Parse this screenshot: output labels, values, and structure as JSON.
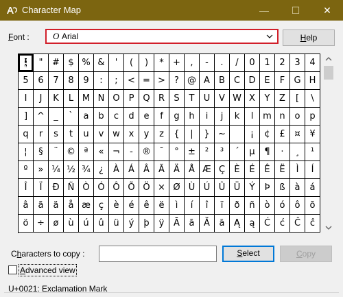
{
  "window": {
    "title": "Character Map",
    "minimize_glyph": "—",
    "maximize_glyph": "☐",
    "close_glyph": "✕"
  },
  "font": {
    "label": "Font :",
    "glyph": "O",
    "value": "Arial"
  },
  "help_button": "Help",
  "grid": {
    "columns": 20,
    "selected_index": 0,
    "chars": [
      "!",
      "\"",
      "#",
      "$",
      "%",
      "&",
      "'",
      "(",
      ")",
      "*",
      "+",
      ",",
      "-",
      ".",
      "/",
      "0",
      "1",
      "2",
      "3",
      "4",
      "5",
      "6",
      "7",
      "8",
      "9",
      ":",
      ";",
      "<",
      "=",
      ">",
      "?",
      "@",
      "A",
      "B",
      "C",
      "D",
      "E",
      "F",
      "G",
      "H",
      "I",
      "J",
      "K",
      "L",
      "M",
      "N",
      "O",
      "P",
      "Q",
      "R",
      "S",
      "T",
      "U",
      "V",
      "W",
      "X",
      "Y",
      "Z",
      "[",
      "\\",
      "]",
      "^",
      "_",
      "`",
      "a",
      "b",
      "c",
      "d",
      "e",
      "f",
      "g",
      "h",
      "i",
      "j",
      "k",
      "l",
      "m",
      "n",
      "o",
      "p",
      "q",
      "r",
      "s",
      "t",
      "u",
      "v",
      "w",
      "x",
      "y",
      "z",
      "{",
      "|",
      "}",
      "~",
      " ",
      "¡",
      "¢",
      "£",
      "¤",
      "¥",
      "¦",
      "§",
      "¨",
      "©",
      "ª",
      "«",
      "¬",
      "-",
      "®",
      "¯",
      "°",
      "±",
      "²",
      "³",
      "´",
      "µ",
      "¶",
      "·",
      "¸",
      "¹",
      "º",
      "»",
      "¼",
      "½",
      "¾",
      "¿",
      "À",
      "Á",
      "Â",
      "Ã",
      "Ä",
      "Å",
      "Æ",
      "Ç",
      "È",
      "É",
      "Ê",
      "Ë",
      "Ì",
      "Í",
      "Î",
      "Ï",
      "Ð",
      "Ñ",
      "Ò",
      "Ó",
      "Ô",
      "Õ",
      "Ö",
      "×",
      "Ø",
      "Ù",
      "Ú",
      "Û",
      "Ü",
      "Ý",
      "Þ",
      "ß",
      "à",
      "á",
      "â",
      "ã",
      "ä",
      "å",
      "æ",
      "ç",
      "è",
      "é",
      "ê",
      "ë",
      "ì",
      "í",
      "î",
      "ï",
      "ð",
      "ñ",
      "ò",
      "ó",
      "ô",
      "õ",
      "ö",
      "÷",
      "ø",
      "ù",
      "ú",
      "û",
      "ü",
      "ý",
      "þ",
      "ÿ",
      "Ā",
      "ā",
      "Ă",
      "ă",
      "Ą",
      "ą",
      "Ć",
      "ć",
      "Ĉ",
      "ĉ"
    ]
  },
  "copy": {
    "label": "Characters to copy :",
    "value": "",
    "select_button": "Select",
    "copy_button": "Copy"
  },
  "advanced_view": {
    "label": "Advanced view",
    "checked": false
  },
  "status": "U+0021: Exclamation Mark"
}
